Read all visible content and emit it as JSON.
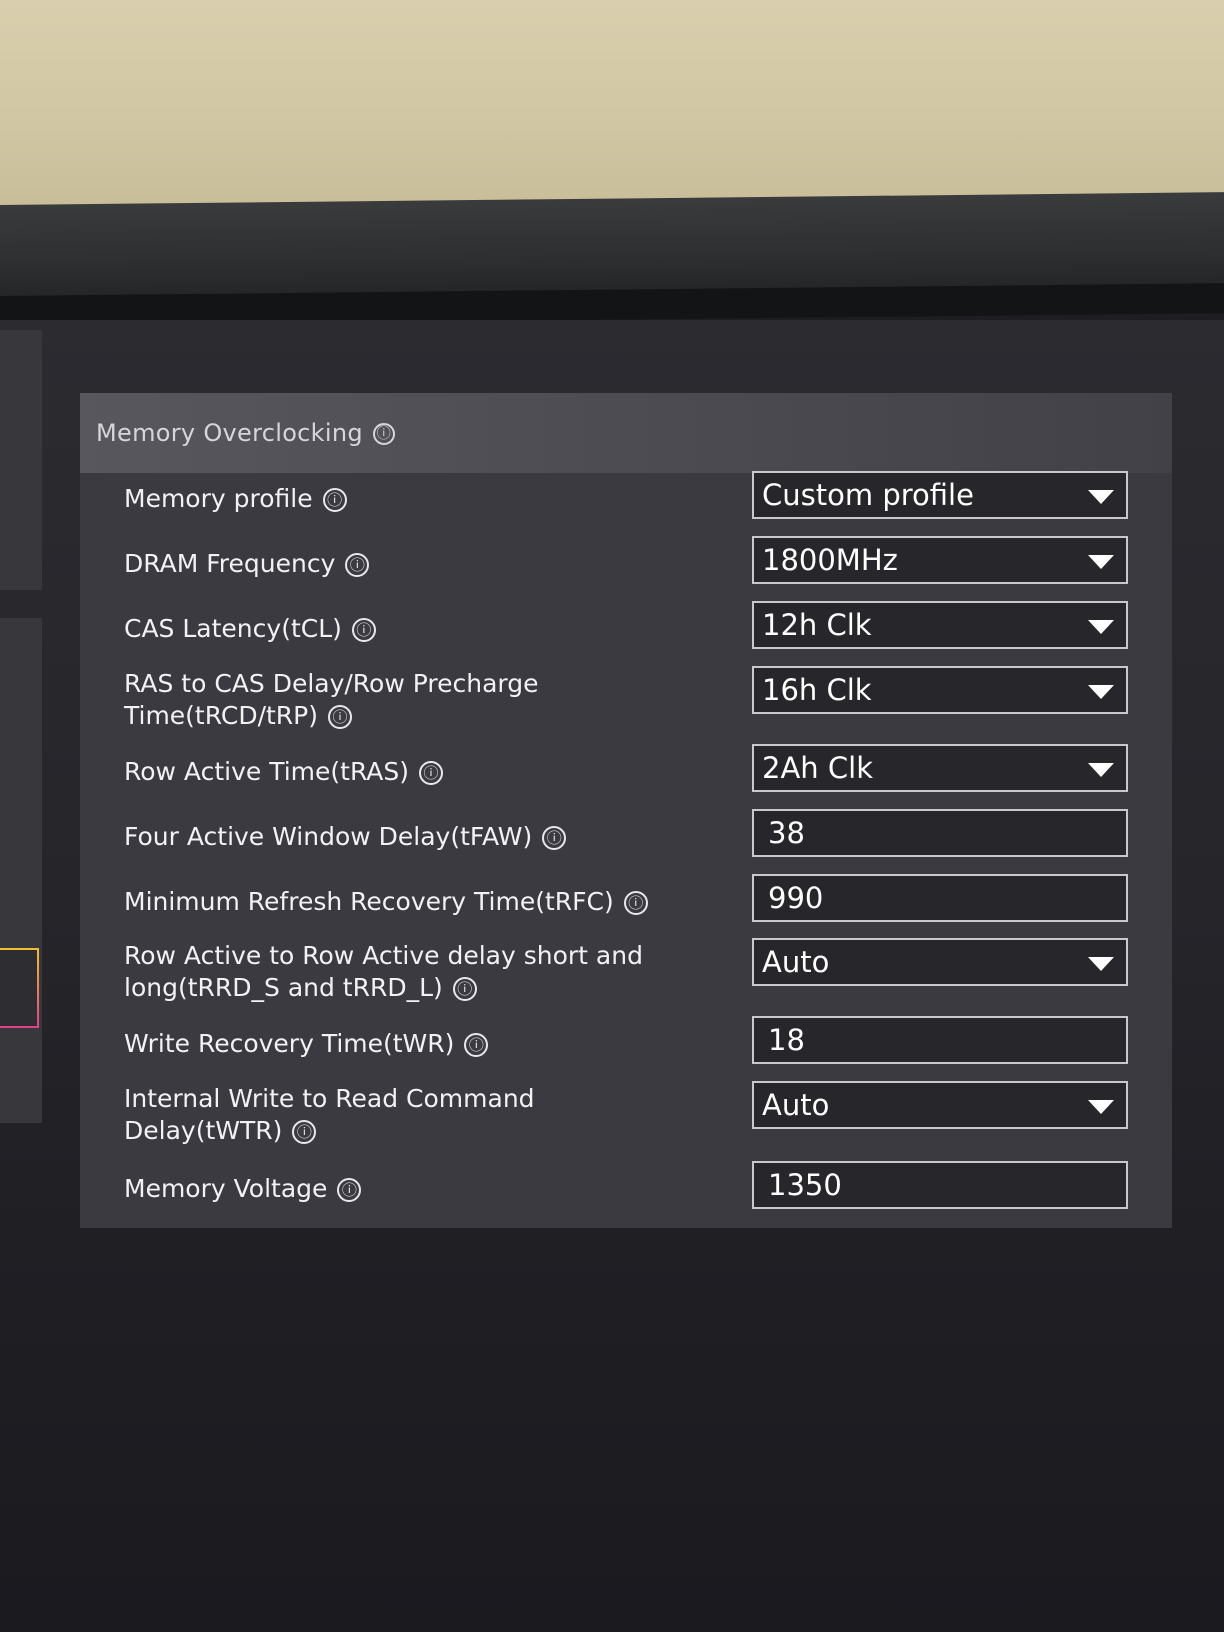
{
  "panel": {
    "title": "Memory Overclocking",
    "info_icon": "ⓘ"
  },
  "settings": [
    {
      "label_1": "Memory profile",
      "label_2": "",
      "value": "Custom profile",
      "type": "dropdown"
    },
    {
      "label_1": "DRAM Frequency",
      "label_2": "",
      "value": "1800MHz",
      "type": "dropdown"
    },
    {
      "label_1": "CAS Latency(tCL)",
      "label_2": "",
      "value": "12h Clk",
      "type": "dropdown"
    },
    {
      "label_1": "RAS to CAS Delay/Row Precharge",
      "label_2": "Time(tRCD/tRP)",
      "value": "16h Clk",
      "type": "dropdown"
    },
    {
      "label_1": "Row Active Time(tRAS)",
      "label_2": "",
      "value": "2Ah Clk",
      "type": "dropdown"
    },
    {
      "label_1": "Four Active Window Delay(tFAW)",
      "label_2": "",
      "value": "38",
      "type": "input"
    },
    {
      "label_1": "Minimum Refresh Recovery Time(tRFC)",
      "label_2": "",
      "value": "990",
      "type": "input"
    },
    {
      "label_1": "Row Active to Row Active delay short and",
      "label_2": "long(tRRD_S and tRRD_L)",
      "value": "Auto",
      "type": "dropdown"
    },
    {
      "label_1": "Write Recovery Time(tWR)",
      "label_2": "",
      "value": "18",
      "type": "input"
    },
    {
      "label_1": "Internal Write to Read Command",
      "label_2": "Delay(tWTR)",
      "value": "Auto",
      "type": "dropdown"
    },
    {
      "label_1": "Memory Voltage",
      "label_2": "",
      "value": "1350",
      "type": "input"
    }
  ]
}
